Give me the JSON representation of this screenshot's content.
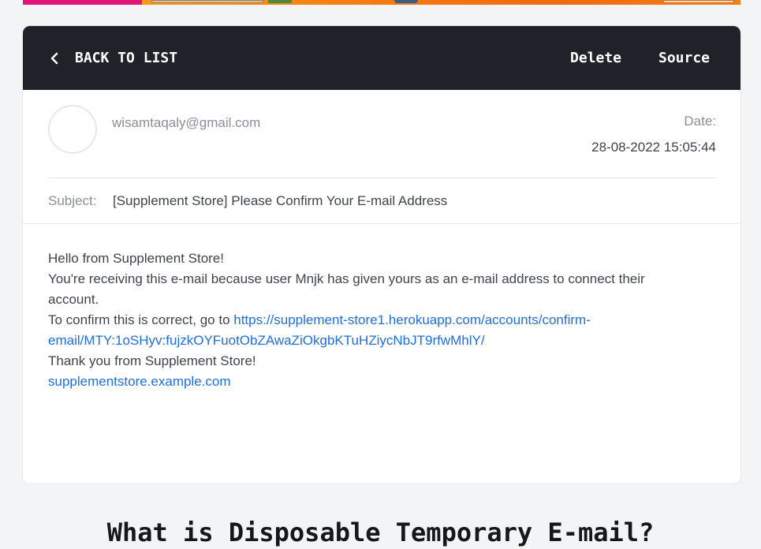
{
  "toolbar": {
    "back_label": "BACK TO LIST",
    "delete_label": "Delete",
    "source_label": "Source"
  },
  "header": {
    "sender": "wisamtaqaly@gmail.com",
    "date_label": "Date:",
    "date_value": "28-08-2022 15:05:44"
  },
  "subject": {
    "label": "Subject:",
    "text": "[Supplement Store] Please Confirm Your E-mail Address"
  },
  "body": {
    "greeting": "Hello from Supplement Store!",
    "line2": "You're receiving this e-mail because user Mnjk has given yours as an e-mail address to connect their account.",
    "confirm_prefix": "To confirm this is correct, go to ",
    "confirm_link": "https://supplement-store1.herokuapp.com/accounts/confirm-email/MTY:1oSHyv:fujzkOYFuotObZAwaZiOkgbKTuHZiycNbJT9rfwMhlY/",
    "thanks": "Thank you from Supplement Store!",
    "site_link": "supplementstore.example.com"
  },
  "section": {
    "title": "What is Disposable Temporary E-mail?"
  },
  "colors": {
    "toolbar_bg": "#1f2229",
    "link": "#1f6fe0",
    "page_bg": "#f3f4f6"
  },
  "icons": {
    "back": "chevron-left-icon"
  }
}
